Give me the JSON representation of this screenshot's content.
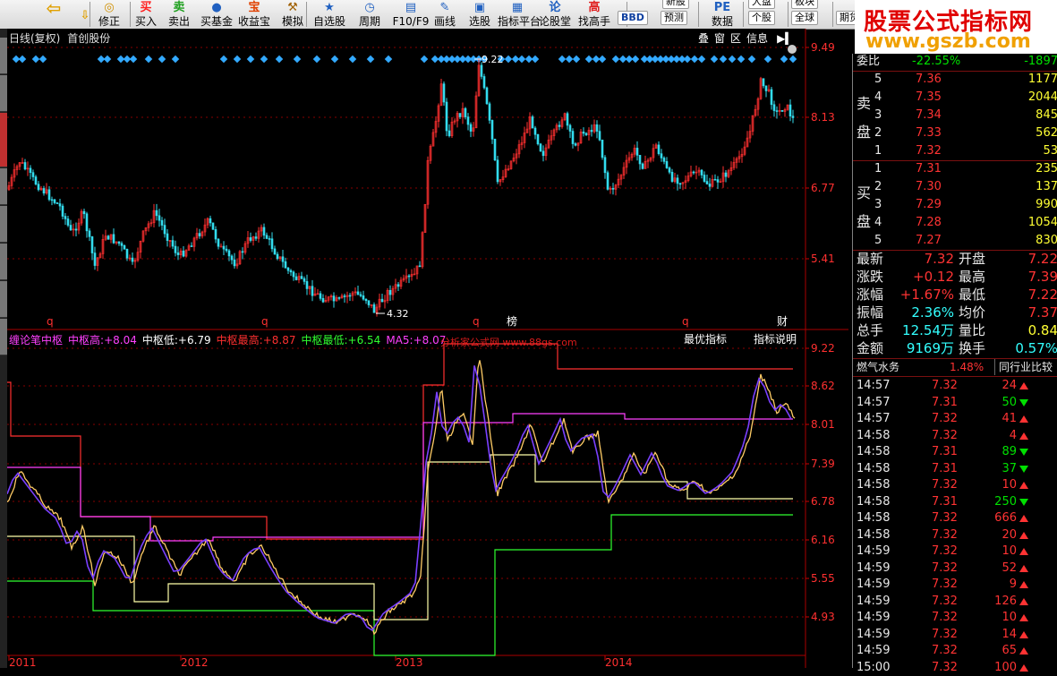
{
  "toolbar": [
    {
      "label": "修正",
      "icon": "◎",
      "color": "#d09000"
    },
    {
      "label": "买入",
      "icon": "买",
      "color": "#ff2020"
    },
    {
      "label": "卖出",
      "icon": "卖",
      "color": "#20a020"
    },
    {
      "label": "买基金",
      "icon": "●",
      "color": "#2060c0"
    },
    {
      "label": "收益宝",
      "icon": "宝",
      "color": "#e04000"
    },
    {
      "label": "模拟",
      "icon": "⚒",
      "color": "#a06000"
    },
    {
      "label": "自选股",
      "icon": "★",
      "color": "#2060c0"
    },
    {
      "label": "周期",
      "icon": "◷",
      "color": "#2060c0"
    },
    {
      "label": "F10/F9",
      "icon": "▤",
      "color": "#2060c0"
    },
    {
      "label": "画线",
      "icon": "✎",
      "color": "#2060c0"
    },
    {
      "label": "选股",
      "icon": "▣",
      "color": "#2060c0"
    },
    {
      "label": "指标平台",
      "icon": "▦",
      "color": "#2060c0"
    },
    {
      "label": "论股堂",
      "icon": "论",
      "color": "#2060c0"
    },
    {
      "label": "找高手",
      "icon": "高",
      "color": "#e02020"
    },
    {
      "label": "数据",
      "icon": "PE",
      "color": "#2060c0"
    }
  ],
  "toolbar_small": [
    "新股",
    "BBD",
    "预测",
    "个股",
    "全球",
    "期货",
    "大盘",
    "板块"
  ],
  "logo": {
    "line1": "股票公式指标网",
    "line2": "www.gszb.com"
  },
  "chart_header": {
    "period": "日线(复权)",
    "stock": "首创股份"
  },
  "chart_controls": [
    "叠",
    "窗",
    "区",
    "信息"
  ],
  "price_axis": [
    "9.49",
    "8.13",
    "6.77",
    "5.41"
  ],
  "price_labels": {
    "high": "9.22",
    "low": "4.32"
  },
  "markers": [
    {
      "text": "q",
      "color": "#ff3030"
    },
    {
      "text": "q",
      "color": "#ff3030"
    },
    {
      "text": "q",
      "color": "#ff3030"
    },
    {
      "text": "榜",
      "color": "#ffffff"
    },
    {
      "text": "q",
      "color": "#ff3030"
    },
    {
      "text": "财",
      "color": "#ffffff"
    }
  ],
  "indicator": {
    "name": "缠论笔中枢",
    "items": [
      {
        "label": "中枢高:",
        "value": "+8.04",
        "color": "#ff40ff"
      },
      {
        "label": "中枢低:",
        "value": "+6.79",
        "color": "#ffffff"
      },
      {
        "label": "中枢最高:",
        "value": "+8.87",
        "color": "#ff3030"
      },
      {
        "label": "中枢最低:",
        "value": "+6.54",
        "color": "#30ff30"
      },
      {
        "label": "MA5:",
        "value": "+8.07",
        "color": "#ff40ff"
      }
    ],
    "watermark": "分析家公式网 www.88gs.com",
    "btn_best": "最优指标",
    "btn_help": "指标说明"
  },
  "indicator_axis": [
    "9.22",
    "8.62",
    "8.01",
    "7.39",
    "6.78",
    "6.16",
    "5.55",
    "4.93"
  ],
  "x_axis": [
    "2011",
    "2012",
    "2013",
    "2014"
  ],
  "quote": {
    "weibi_label": "委比",
    "weibi": "-22.55%",
    "weicha": "-1897",
    "sell_label": [
      "卖",
      "盘"
    ],
    "buy_label": [
      "买",
      "盘"
    ],
    "sell": [
      {
        "n": "5",
        "p": "7.36",
        "v": "1177"
      },
      {
        "n": "4",
        "p": "7.35",
        "v": "2044"
      },
      {
        "n": "3",
        "p": "7.34",
        "v": "845"
      },
      {
        "n": "2",
        "p": "7.33",
        "v": "562"
      },
      {
        "n": "1",
        "p": "7.32",
        "v": "53"
      }
    ],
    "buy": [
      {
        "n": "1",
        "p": "7.31",
        "v": "235"
      },
      {
        "n": "2",
        "p": "7.30",
        "v": "137"
      },
      {
        "n": "3",
        "p": "7.29",
        "v": "990"
      },
      {
        "n": "4",
        "p": "7.28",
        "v": "1054"
      },
      {
        "n": "5",
        "p": "7.27",
        "v": "830"
      }
    ],
    "stats": [
      {
        "l1": "最新",
        "v1": "7.32",
        "c1": "red",
        "l2": "开盘",
        "v2": "7.22",
        "c2": "red"
      },
      {
        "l1": "涨跌",
        "v1": "+0.12",
        "c1": "red",
        "l2": "最高",
        "v2": "7.39",
        "c2": "red"
      },
      {
        "l1": "涨幅",
        "v1": "+1.67%",
        "c1": "red",
        "l2": "最低",
        "v2": "7.22",
        "c2": "red"
      },
      {
        "l1": "振幅",
        "v1": "2.36%",
        "c1": "cyan",
        "l2": "均价",
        "v2": "7.37",
        "c2": "red"
      },
      {
        "l1": "总手",
        "v1": "12.54万",
        "c1": "cyan",
        "l2": "量比",
        "v2": "0.84",
        "c2": "yel"
      },
      {
        "l1": "金额",
        "v1": "9169万",
        "c1": "cyan",
        "l2": "换手",
        "v2": "0.57%",
        "c2": "cyan"
      }
    ],
    "industry": "燃气水务",
    "industry_pct": "1.48%",
    "industry_btn": "同行业比较",
    "ticks": [
      {
        "t": "14:57",
        "p": "7.32",
        "v": "24",
        "d": "up"
      },
      {
        "t": "14:57",
        "p": "7.31",
        "v": "50",
        "d": "dn"
      },
      {
        "t": "14:57",
        "p": "7.32",
        "v": "41",
        "d": "up"
      },
      {
        "t": "14:58",
        "p": "7.32",
        "v": "4",
        "d": "up"
      },
      {
        "t": "14:58",
        "p": "7.31",
        "v": "89",
        "d": "dn"
      },
      {
        "t": "14:58",
        "p": "7.31",
        "v": "37",
        "d": "dn"
      },
      {
        "t": "14:58",
        "p": "7.32",
        "v": "10",
        "d": "up"
      },
      {
        "t": "14:58",
        "p": "7.31",
        "v": "250",
        "d": "dn"
      },
      {
        "t": "14:58",
        "p": "7.32",
        "v": "666",
        "d": "up"
      },
      {
        "t": "14:58",
        "p": "7.32",
        "v": "20",
        "d": "up"
      },
      {
        "t": "14:59",
        "p": "7.32",
        "v": "10",
        "d": "up"
      },
      {
        "t": "14:59",
        "p": "7.32",
        "v": "52",
        "d": "up"
      },
      {
        "t": "14:59",
        "p": "7.32",
        "v": "9",
        "d": "up"
      },
      {
        "t": "14:59",
        "p": "7.32",
        "v": "126",
        "d": "up"
      },
      {
        "t": "14:59",
        "p": "7.32",
        "v": "10",
        "d": "up"
      },
      {
        "t": "14:59",
        "p": "7.32",
        "v": "14",
        "d": "up"
      },
      {
        "t": "14:59",
        "p": "7.32",
        "v": "65",
        "d": "up"
      },
      {
        "t": "15:00",
        "p": "7.32",
        "v": "100",
        "d": "up"
      }
    ]
  }
}
